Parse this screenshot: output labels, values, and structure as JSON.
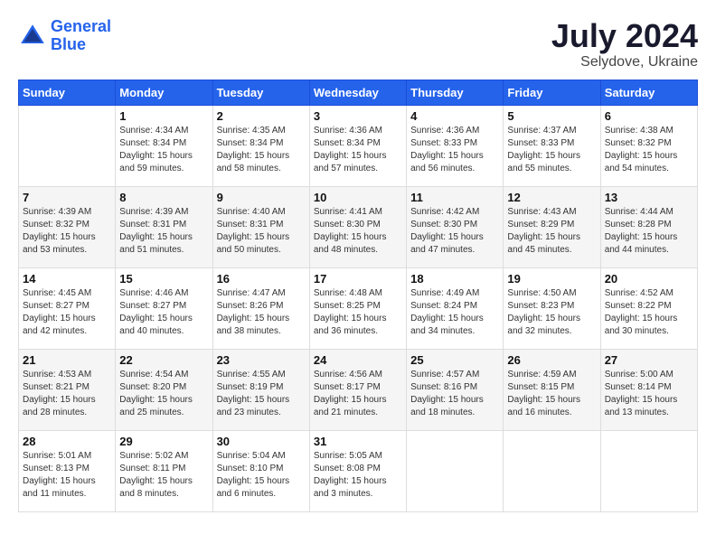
{
  "header": {
    "logo_line1": "General",
    "logo_line2": "Blue",
    "month_year": "July 2024",
    "location": "Selydove, Ukraine"
  },
  "calendar": {
    "days_of_week": [
      "Sunday",
      "Monday",
      "Tuesday",
      "Wednesday",
      "Thursday",
      "Friday",
      "Saturday"
    ],
    "weeks": [
      [
        {
          "day": "",
          "info": ""
        },
        {
          "day": "1",
          "info": "Sunrise: 4:34 AM\nSunset: 8:34 PM\nDaylight: 15 hours\nand 59 minutes."
        },
        {
          "day": "2",
          "info": "Sunrise: 4:35 AM\nSunset: 8:34 PM\nDaylight: 15 hours\nand 58 minutes."
        },
        {
          "day": "3",
          "info": "Sunrise: 4:36 AM\nSunset: 8:34 PM\nDaylight: 15 hours\nand 57 minutes."
        },
        {
          "day": "4",
          "info": "Sunrise: 4:36 AM\nSunset: 8:33 PM\nDaylight: 15 hours\nand 56 minutes."
        },
        {
          "day": "5",
          "info": "Sunrise: 4:37 AM\nSunset: 8:33 PM\nDaylight: 15 hours\nand 55 minutes."
        },
        {
          "day": "6",
          "info": "Sunrise: 4:38 AM\nSunset: 8:32 PM\nDaylight: 15 hours\nand 54 minutes."
        }
      ],
      [
        {
          "day": "7",
          "info": "Sunrise: 4:39 AM\nSunset: 8:32 PM\nDaylight: 15 hours\nand 53 minutes."
        },
        {
          "day": "8",
          "info": "Sunrise: 4:39 AM\nSunset: 8:31 PM\nDaylight: 15 hours\nand 51 minutes."
        },
        {
          "day": "9",
          "info": "Sunrise: 4:40 AM\nSunset: 8:31 PM\nDaylight: 15 hours\nand 50 minutes."
        },
        {
          "day": "10",
          "info": "Sunrise: 4:41 AM\nSunset: 8:30 PM\nDaylight: 15 hours\nand 48 minutes."
        },
        {
          "day": "11",
          "info": "Sunrise: 4:42 AM\nSunset: 8:30 PM\nDaylight: 15 hours\nand 47 minutes."
        },
        {
          "day": "12",
          "info": "Sunrise: 4:43 AM\nSunset: 8:29 PM\nDaylight: 15 hours\nand 45 minutes."
        },
        {
          "day": "13",
          "info": "Sunrise: 4:44 AM\nSunset: 8:28 PM\nDaylight: 15 hours\nand 44 minutes."
        }
      ],
      [
        {
          "day": "14",
          "info": "Sunrise: 4:45 AM\nSunset: 8:27 PM\nDaylight: 15 hours\nand 42 minutes."
        },
        {
          "day": "15",
          "info": "Sunrise: 4:46 AM\nSunset: 8:27 PM\nDaylight: 15 hours\nand 40 minutes."
        },
        {
          "day": "16",
          "info": "Sunrise: 4:47 AM\nSunset: 8:26 PM\nDaylight: 15 hours\nand 38 minutes."
        },
        {
          "day": "17",
          "info": "Sunrise: 4:48 AM\nSunset: 8:25 PM\nDaylight: 15 hours\nand 36 minutes."
        },
        {
          "day": "18",
          "info": "Sunrise: 4:49 AM\nSunset: 8:24 PM\nDaylight: 15 hours\nand 34 minutes."
        },
        {
          "day": "19",
          "info": "Sunrise: 4:50 AM\nSunset: 8:23 PM\nDaylight: 15 hours\nand 32 minutes."
        },
        {
          "day": "20",
          "info": "Sunrise: 4:52 AM\nSunset: 8:22 PM\nDaylight: 15 hours\nand 30 minutes."
        }
      ],
      [
        {
          "day": "21",
          "info": "Sunrise: 4:53 AM\nSunset: 8:21 PM\nDaylight: 15 hours\nand 28 minutes."
        },
        {
          "day": "22",
          "info": "Sunrise: 4:54 AM\nSunset: 8:20 PM\nDaylight: 15 hours\nand 25 minutes."
        },
        {
          "day": "23",
          "info": "Sunrise: 4:55 AM\nSunset: 8:19 PM\nDaylight: 15 hours\nand 23 minutes."
        },
        {
          "day": "24",
          "info": "Sunrise: 4:56 AM\nSunset: 8:17 PM\nDaylight: 15 hours\nand 21 minutes."
        },
        {
          "day": "25",
          "info": "Sunrise: 4:57 AM\nSunset: 8:16 PM\nDaylight: 15 hours\nand 18 minutes."
        },
        {
          "day": "26",
          "info": "Sunrise: 4:59 AM\nSunset: 8:15 PM\nDaylight: 15 hours\nand 16 minutes."
        },
        {
          "day": "27",
          "info": "Sunrise: 5:00 AM\nSunset: 8:14 PM\nDaylight: 15 hours\nand 13 minutes."
        }
      ],
      [
        {
          "day": "28",
          "info": "Sunrise: 5:01 AM\nSunset: 8:13 PM\nDaylight: 15 hours\nand 11 minutes."
        },
        {
          "day": "29",
          "info": "Sunrise: 5:02 AM\nSunset: 8:11 PM\nDaylight: 15 hours\nand 8 minutes."
        },
        {
          "day": "30",
          "info": "Sunrise: 5:04 AM\nSunset: 8:10 PM\nDaylight: 15 hours\nand 6 minutes."
        },
        {
          "day": "31",
          "info": "Sunrise: 5:05 AM\nSunset: 8:08 PM\nDaylight: 15 hours\nand 3 minutes."
        },
        {
          "day": "",
          "info": ""
        },
        {
          "day": "",
          "info": ""
        },
        {
          "day": "",
          "info": ""
        }
      ]
    ]
  }
}
